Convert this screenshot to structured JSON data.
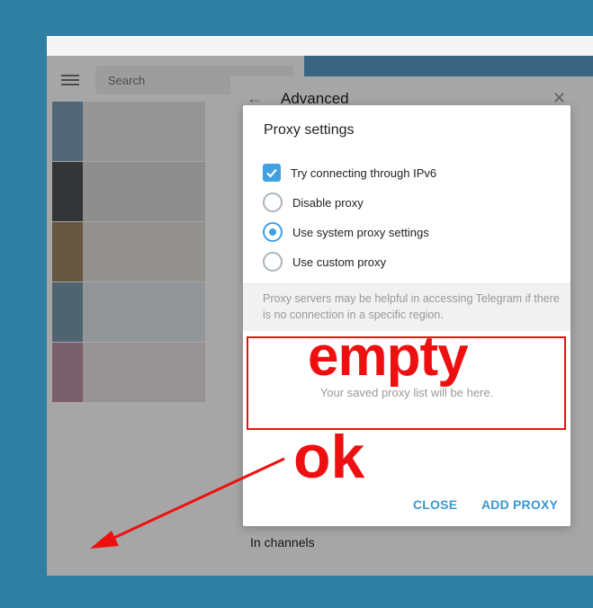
{
  "sidebar": {
    "search_placeholder": "Search",
    "chat_colors": [
      [
        "#7f9fb4",
        "#cfcfcf"
      ],
      [
        "#4f5254",
        "#bcbcbc"
      ],
      [
        "#9f8466",
        "#c9c4bd"
      ],
      [
        "#7b98ad",
        "#c7d3db"
      ],
      [
        "#b893a4",
        "#d5c7cd"
      ]
    ]
  },
  "advanced_panel": {
    "title": "Advanced",
    "in_channels": "In channels"
  },
  "dialog": {
    "title": "Proxy settings",
    "options": {
      "ipv6": "Try connecting through IPv6",
      "disable": "Disable proxy",
      "system": "Use system proxy settings",
      "custom": "Use custom proxy"
    },
    "ipv6_checked": true,
    "selected_option": "Use system proxy settings",
    "info_text": "Proxy servers may be helpful in accessing Telegram if there is no connection in a specific region.",
    "empty_text": "Your saved proxy list will be here.",
    "close_label": "CLOSE",
    "add_proxy_label": "ADD PROXY"
  },
  "annotations": {
    "empty_label": "empty",
    "ok_label": "ok",
    "color": "#ee1010"
  },
  "colors": {
    "accent": "#3fa1e0",
    "desktop": "#2e7fa1"
  }
}
